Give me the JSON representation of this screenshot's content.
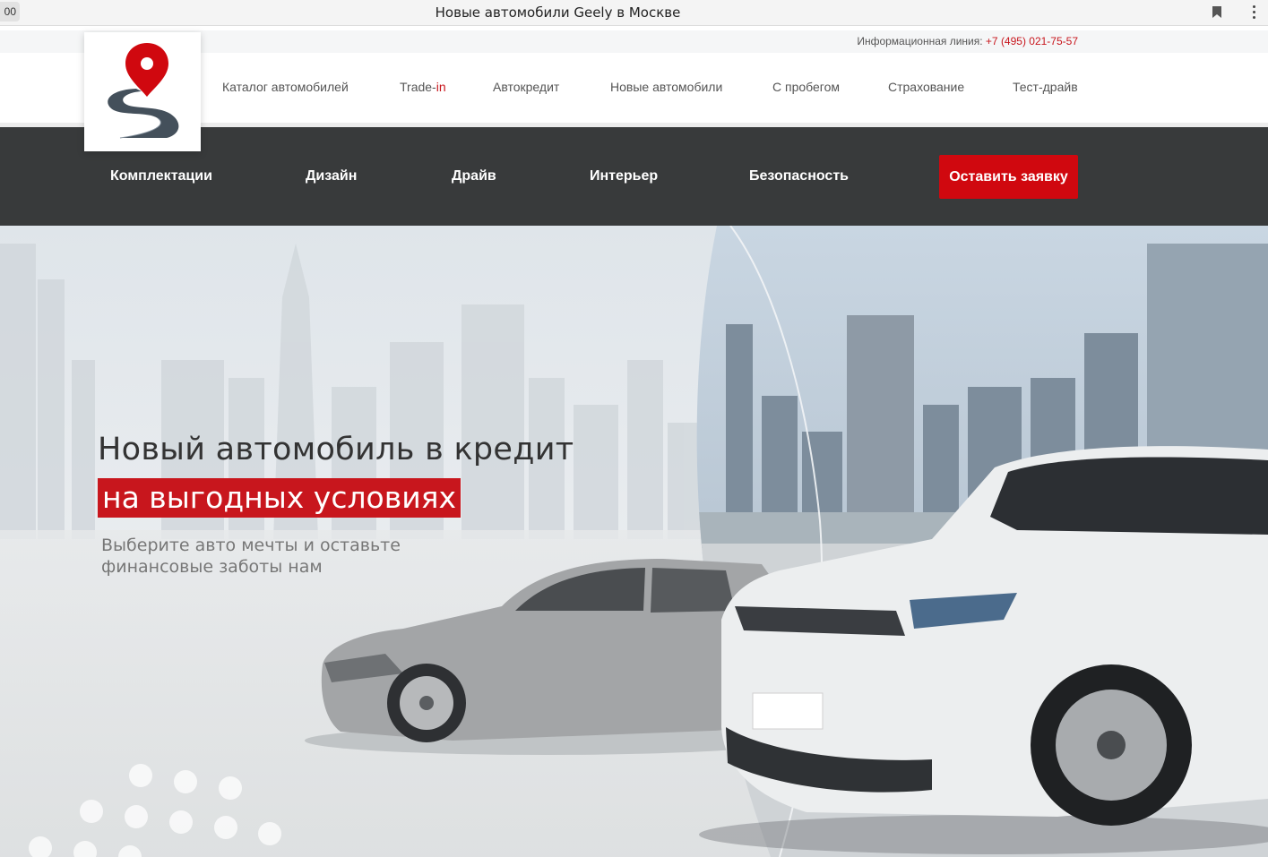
{
  "browser": {
    "tab_fragment": "00",
    "window_title": "Новые автомобили Geely в Москве"
  },
  "info": {
    "label": "Информационная линия: ",
    "phone": "+7 (495) 021-75-57"
  },
  "main_nav": {
    "catalog": "Каталог автомобилей",
    "tradein_a": "Trade-",
    "tradein_b": "in",
    "credit": "Автокредит",
    "new_cars": "Новые автомобили",
    "used": "С пробегом",
    "insurance": "Страхование",
    "test_drive": "Тест-драйв"
  },
  "sub_nav": {
    "trims": "Комплектации",
    "design": "Дизайн",
    "drive": "Драйв",
    "interior": "Интерьер",
    "safety": "Безопасность",
    "cta": "Оставить заявку"
  },
  "hero": {
    "line1": "Новый автомобиль в кредит",
    "line2": "на выгодных условиях",
    "sub": "Выберите авто мечты и оставьте финансовые заботы нам"
  },
  "colors": {
    "accent": "#c8161d",
    "dark_nav": "#383a3b"
  }
}
